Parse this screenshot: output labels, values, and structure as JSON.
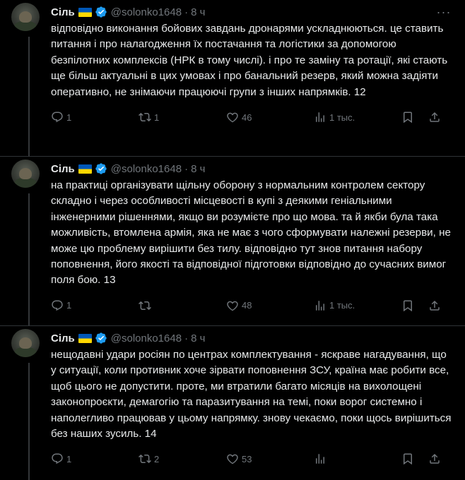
{
  "tweets": [
    {
      "name": "Сіль",
      "handle": "@solonko1648",
      "time": "8 ч",
      "text": "відповідно виконання бойових завдань дронарями ускладнюються. це ставить питання і про налагодження їх постачання та логістики за допомогою безпілотних комплексів (НРК в тому числі). і про те заміну та ротації, які стають ще більш актуальні в цих умовах і про банальний резерв, який можна задіяти оперативно, не знімаючи працюючі групи з інших напрямків.   12",
      "replies": "1",
      "reposts": "1",
      "likes": "46",
      "views": "1 тыс."
    },
    {
      "name": "Сіль",
      "handle": "@solonko1648",
      "time": "8 ч",
      "text": "на практиці організувати щільну оборону з нормальним контролем сектору складно і через особливості місцевості в купі з деякими геніальними інженерними рішеннями, якщо ви розумієте про що мова. та й якби була така можливість, втомлена армія, яка не має з чого сформувати належні резерви, не може цю проблему вирішити без тилу. відповідно тут знов питання набору поповнення, його якості та відповідної підготовки відповідно до сучасних вимог поля бою. 13",
      "replies": "1",
      "reposts": "",
      "likes": "48",
      "views": "1 тыс."
    },
    {
      "name": "Сіль",
      "handle": "@solonko1648",
      "time": "8 ч",
      "text": "нещодавні удари росіян по центрах комплектування - яскраве нагадування, що у ситуації, коли противник хоче зірвати поповнення ЗСУ, країна має робити все, щоб цього не допустити. проте, ми втратили багато місяців на вихолощені законопроєкти, демагогію та паразитування на темі, поки ворог системно і наполегливо працював у цьому напрямку. знову чекаємо, поки щось вирішиться без наших зусиль. 14",
      "replies": "1",
      "reposts": "2",
      "likes": "53",
      "views": ""
    }
  ],
  "icons": {
    "verified": "verified-badge-icon",
    "more": "more-icon",
    "reply": "reply-icon",
    "repost": "repost-icon",
    "like": "heart-icon",
    "views": "views-icon",
    "bookmark": "bookmark-icon",
    "share": "share-icon"
  },
  "colors": {
    "background": "#000000",
    "text": "#e7e9ea",
    "muted": "#71767b",
    "verified": "#1d9bf0",
    "divider": "#2f3336"
  }
}
